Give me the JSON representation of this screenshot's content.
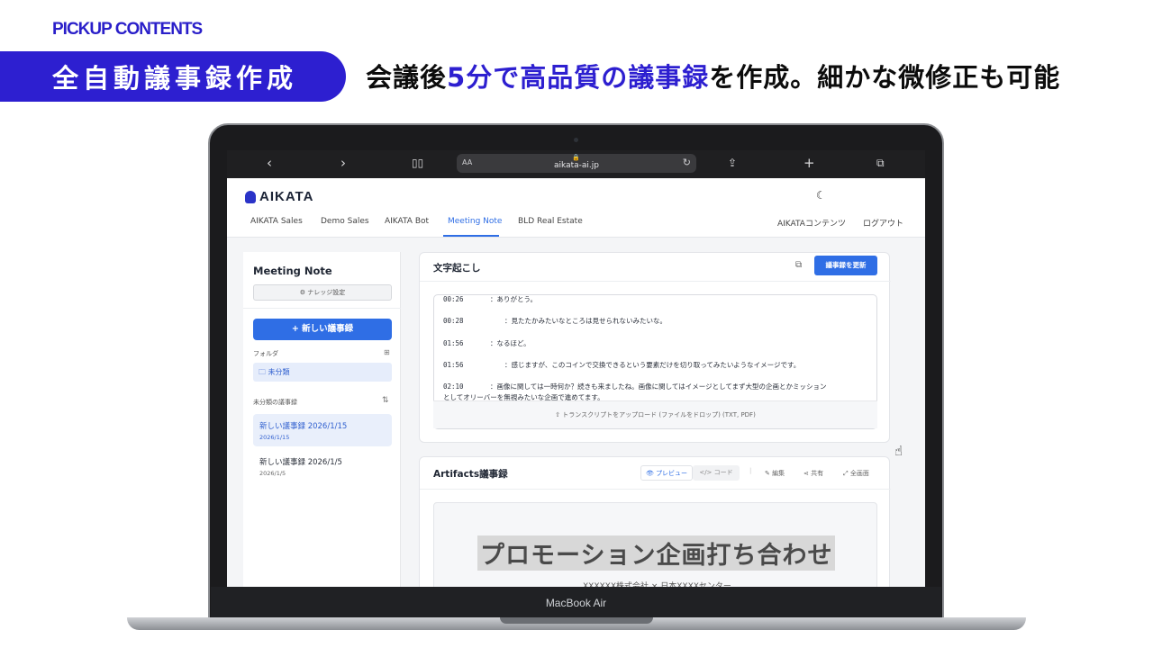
{
  "slide": {
    "pickup": "PICKUP CONTENTS",
    "ribbon": "全自動議事録作成",
    "headline": {
      "pre": "会議後",
      "hl1": "5分で高品質の議事録",
      "post": "を作成。細かな微修正も可能"
    }
  },
  "device": {
    "brand": "MacBook Air"
  },
  "browser": {
    "aa": "AA",
    "url": "aikata-ai.jp"
  },
  "app": {
    "logo": "AIKATA",
    "tabs": [
      "AIKATA Sales",
      "Demo Sales",
      "AIKATA Bot",
      "Meeting Note",
      "BLD Real Estate"
    ],
    "active_tab": "Meeting Note",
    "right_links": [
      "AIKATAコンテンツ",
      "ログアウト"
    ]
  },
  "sidebar": {
    "title": "Meeting Note",
    "knowledge_btn": "ナレッジ設定",
    "new_btn": "+ 新しい議事録",
    "folder_label": "フォルダ",
    "folder": "未分類",
    "uncat_label": "未分類の議事録",
    "items": [
      {
        "title": "新しい議事録 2026/1/15",
        "date": "2026/1/15"
      },
      {
        "title": "新しい議事録 2026/1/5",
        "date": "2026/1/5"
      }
    ]
  },
  "transcript": {
    "title": "文字起こし",
    "update_btn": "議事録を更新",
    "lines": [
      {
        "time": "00:26",
        "text": "：ありがとう。"
      },
      {
        "time": "00:28",
        "text": "：見たたかみたいなところは見せられないみたいな。"
      },
      {
        "time": "01:56",
        "text": "：なるほど。"
      },
      {
        "time": "01:56",
        "text": "：感じますが、このコインで交換できるという要素だけを切り取ってみたいようなイメージです。"
      },
      {
        "time": "02:10",
        "text": "：画像に関しては一時何か？続きも来ましたね。画像に関してはイメージとしてまず大型の企画とかミッション"
      }
    ],
    "line_cont": "としてオリーバーを無視みたいな企画で進めてます。",
    "upload": "トランスクリプトをアップロード (ファイルをドロップ) (TXT, PDF)"
  },
  "artifacts": {
    "title": "Artifacts議事録",
    "preview": "プレビュー",
    "code": "コード",
    "edit": "編集",
    "share": "共有",
    "fullscreen": "全画面",
    "doc_title": "プロモーション企画打ち合わせ",
    "doc_sub": "XXXXXX株式会社 × 日本XXXXセンター"
  }
}
